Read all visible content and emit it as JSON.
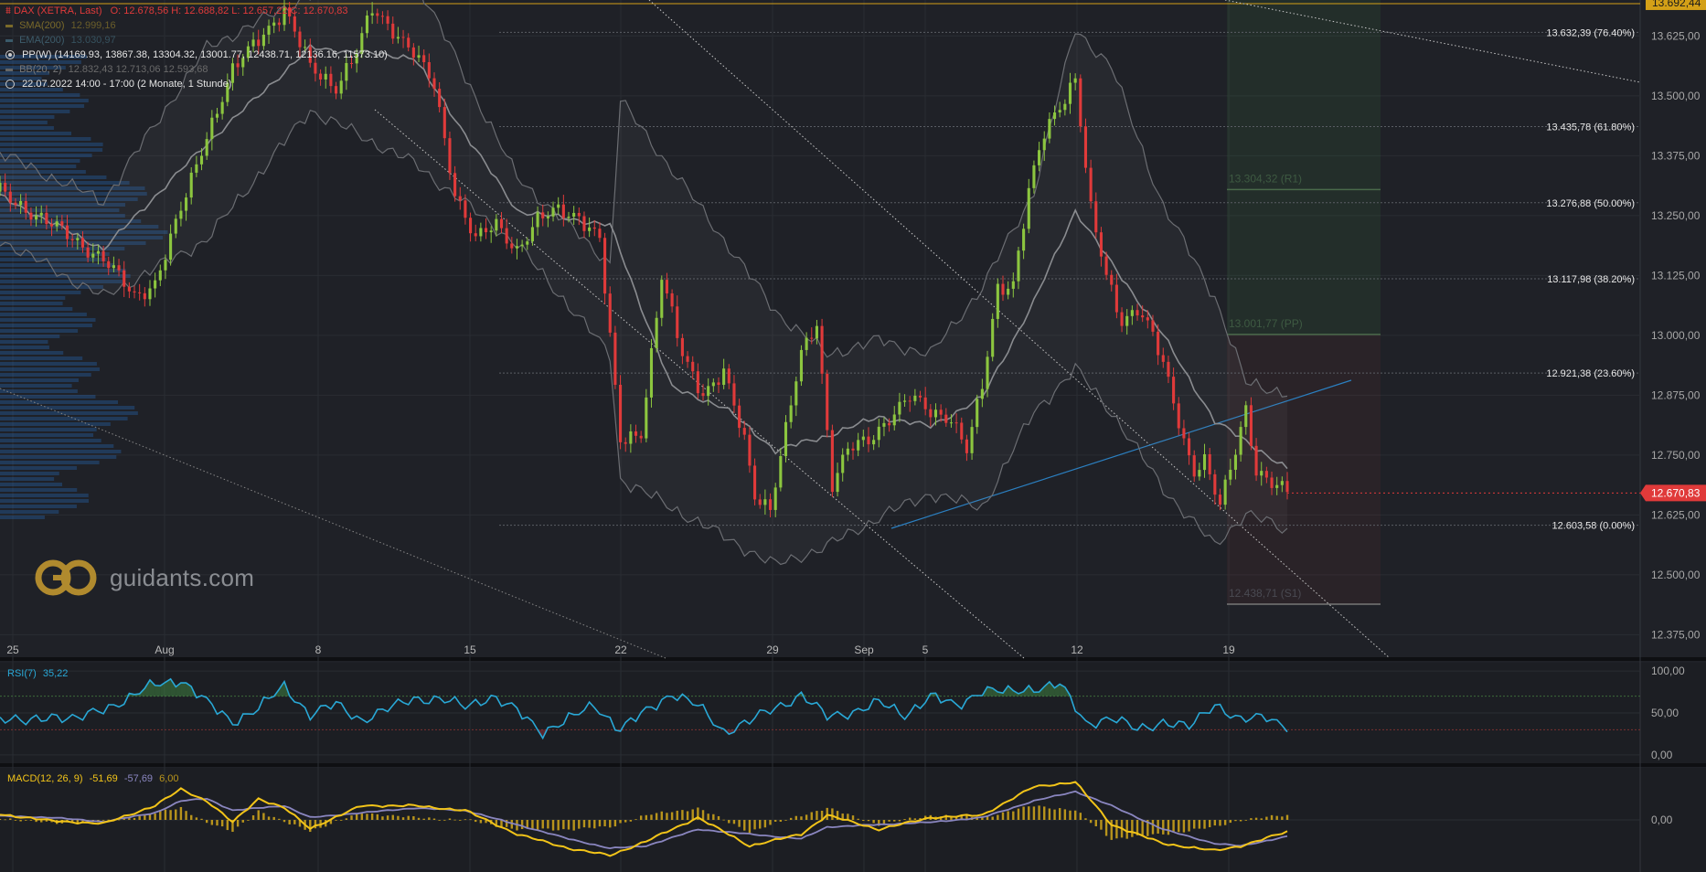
{
  "header": {
    "instrument": "DAX (XETRA, Last)",
    "ohlc": "O: 12.678,56  H: 12.688,82  L: 12.657,22  C: 12.670,83",
    "sma_label": "SMA(200)",
    "sma_value": "12.999,16",
    "ema_label": "EMA(200)",
    "ema_value": "13.030,97",
    "pp_line": "PP(W)  (14169.93, 13867.38, 13304.32, 13001.77, 12438.71, 12136.16, 11573.10)",
    "bb_label": "BB(20, 2)",
    "bb_values": "12.832,43  12.713,06  12.593,68",
    "time_line": "22.07.2022 14:00 - 17:00   (2 Monate, 1 Stunde)"
  },
  "logo": {
    "text": "guidants.com"
  },
  "colors": {
    "background": "#1f2127",
    "bull": "#8cc63f",
    "bear": "#e03a3a",
    "rsi": "#29a8d6",
    "macd": "#f2c419",
    "signal": "#8a86c0",
    "histogram": "#b8941c",
    "last_price_tag": "#e03a3a",
    "top_price_tag": "#d4a017"
  },
  "chart_data": [
    {
      "type": "candlestick",
      "ylim": [
        12330,
        13700
      ],
      "y_ticks": [
        "13.625,00",
        "13.500,00",
        "13.375,00",
        "13.250,00",
        "13.125,00",
        "13.000,00",
        "12.875,00",
        "12.750,00",
        "12.625,00",
        "12.500,00",
        "12.375,00"
      ],
      "x_ticks": [
        "25",
        "Aug",
        "8",
        "15",
        "22",
        "29",
        "Sep",
        "5",
        "12",
        "19"
      ],
      "last_price": "12.670,83",
      "top_price": "13.692,44",
      "fib_levels": [
        {
          "label": "13.632,39 (76.40%)",
          "value": 13632.39
        },
        {
          "label": "13.435,78 (61.80%)",
          "value": 13435.78
        },
        {
          "label": "13.276,88 (50.00%)",
          "value": 13276.88
        },
        {
          "label": "13.117,98 (38.20%)",
          "value": 13117.98
        },
        {
          "label": "12.921,38 (23.60%)",
          "value": 12921.38
        },
        {
          "label": "12.603,58 (0.00%)",
          "value": 12603.58
        }
      ],
      "pivot_levels": [
        {
          "label": "13.304,32 (R1)",
          "value": 13304.32
        },
        {
          "label": "13.001,77 (PP)",
          "value": 13001.77
        },
        {
          "label": "12.438,71 (S1)",
          "value": 12438.71
        }
      ],
      "close_path": [
        [
          0,
          13300
        ],
        [
          10,
          13230
        ],
        [
          20,
          13160
        ],
        [
          26,
          13080
        ],
        [
          30,
          13110
        ],
        [
          35,
          13260
        ],
        [
          40,
          13420
        ],
        [
          45,
          13550
        ],
        [
          50,
          13620
        ],
        [
          55,
          13680
        ],
        [
          60,
          13560
        ],
        [
          65,
          13520
        ],
        [
          69,
          13590
        ],
        [
          72,
          13680
        ],
        [
          76,
          13640
        ],
        [
          80,
          13590
        ],
        [
          84,
          13520
        ],
        [
          88,
          13300
        ],
        [
          92,
          13200
        ],
        [
          96,
          13230
        ],
        [
          100,
          13180
        ],
        [
          104,
          13240
        ],
        [
          108,
          13260
        ],
        [
          112,
          13250
        ],
        [
          116,
          13200
        ],
        [
          120,
          12780
        ],
        [
          124,
          12800
        ],
        [
          128,
          13120
        ],
        [
          132,
          12960
        ],
        [
          136,
          12880
        ],
        [
          140,
          12920
        ],
        [
          144,
          12780
        ],
        [
          146,
          12670
        ],
        [
          149,
          12640
        ],
        [
          152,
          12800
        ],
        [
          155,
          12960
        ],
        [
          158,
          13030
        ],
        [
          161,
          12690
        ],
        [
          164,
          12760
        ],
        [
          168,
          12780
        ],
        [
          172,
          12830
        ],
        [
          176,
          12870
        ],
        [
          180,
          12840
        ],
        [
          184,
          12830
        ],
        [
          187,
          12760
        ],
        [
          190,
          12890
        ],
        [
          193,
          13100
        ],
        [
          196,
          13110
        ],
        [
          199,
          13300
        ],
        [
          202,
          13420
        ],
        [
          205,
          13480
        ],
        [
          208,
          13540
        ],
        [
          211,
          13260
        ],
        [
          214,
          13120
        ],
        [
          217,
          13030
        ],
        [
          220,
          13060
        ],
        [
          223,
          13000
        ],
        [
          226,
          12900
        ],
        [
          229,
          12780
        ],
        [
          231,
          12720
        ],
        [
          233,
          12740
        ],
        [
          236,
          12640
        ],
        [
          239,
          12760
        ],
        [
          241,
          12850
        ],
        [
          243,
          12720
        ],
        [
          246,
          12690
        ],
        [
          249,
          12670
        ]
      ],
      "bollinger": {
        "upper": [
          [
            0,
            13380
          ],
          [
            20,
            13280
          ],
          [
            40,
            13600
          ],
          [
            60,
            13710
          ],
          [
            80,
            13750
          ],
          [
            100,
            13330
          ],
          [
            118,
            13150
          ],
          [
            120,
            13490
          ],
          [
            140,
            13200
          ],
          [
            150,
            13050
          ],
          [
            160,
            12960
          ],
          [
            170,
            12990
          ],
          [
            180,
            12960
          ],
          [
            190,
            13100
          ],
          [
            200,
            13300
          ],
          [
            208,
            13640
          ],
          [
            215,
            13560
          ],
          [
            225,
            13270
          ],
          [
            235,
            13080
          ],
          [
            241,
            12900
          ],
          [
            249,
            12880
          ]
        ],
        "middle": [
          [
            0,
            13290
          ],
          [
            20,
            13180
          ],
          [
            40,
            13400
          ],
          [
            60,
            13600
          ],
          [
            80,
            13580
          ],
          [
            100,
            13260
          ],
          [
            118,
            13230
          ],
          [
            130,
            12890
          ],
          [
            140,
            12850
          ],
          [
            150,
            12760
          ],
          [
            160,
            12790
          ],
          [
            170,
            12830
          ],
          [
            180,
            12810
          ],
          [
            190,
            12870
          ],
          [
            200,
            13070
          ],
          [
            208,
            13260
          ],
          [
            215,
            13150
          ],
          [
            225,
            13000
          ],
          [
            235,
            12820
          ],
          [
            241,
            12780
          ],
          [
            249,
            12720
          ]
        ],
        "lower": [
          [
            0,
            13200
          ],
          [
            20,
            13080
          ],
          [
            40,
            13200
          ],
          [
            60,
            13470
          ],
          [
            80,
            13360
          ],
          [
            100,
            13190
          ],
          [
            118,
            12960
          ],
          [
            120,
            12700
          ],
          [
            140,
            12580
          ],
          [
            150,
            12520
          ],
          [
            160,
            12560
          ],
          [
            170,
            12620
          ],
          [
            180,
            12670
          ],
          [
            190,
            12640
          ],
          [
            200,
            12840
          ],
          [
            208,
            12930
          ],
          [
            215,
            12840
          ],
          [
            225,
            12680
          ],
          [
            235,
            12560
          ],
          [
            241,
            12630
          ],
          [
            249,
            12590
          ]
        ]
      }
    },
    {
      "type": "line",
      "title": "RSI(7)",
      "last_value": "35,22",
      "ylim": [
        -10,
        110
      ],
      "y_ticks": [
        "100,00",
        "50,00",
        "0,00"
      ],
      "levels": [
        70,
        30
      ],
      "values": [
        [
          0,
          45
        ],
        [
          5,
          38
        ],
        [
          10,
          48
        ],
        [
          15,
          42
        ],
        [
          20,
          55
        ],
        [
          25,
          68
        ],
        [
          30,
          84
        ],
        [
          35,
          90
        ],
        [
          40,
          62
        ],
        [
          45,
          40
        ],
        [
          50,
          55
        ],
        [
          55,
          82
        ],
        [
          60,
          48
        ],
        [
          65,
          60
        ],
        [
          70,
          42
        ],
        [
          75,
          54
        ],
        [
          80,
          68
        ],
        [
          85,
          66
        ],
        [
          90,
          58
        ],
        [
          95,
          70
        ],
        [
          100,
          52
        ],
        [
          105,
          28
        ],
        [
          110,
          42
        ],
        [
          115,
          60
        ],
        [
          120,
          30
        ],
        [
          125,
          52
        ],
        [
          130,
          74
        ],
        [
          135,
          58
        ],
        [
          140,
          28
        ],
        [
          145,
          40
        ],
        [
          150,
          56
        ],
        [
          155,
          72
        ],
        [
          160,
          45
        ],
        [
          165,
          52
        ],
        [
          170,
          62
        ],
        [
          175,
          48
        ],
        [
          180,
          70
        ],
        [
          185,
          58
        ],
        [
          190,
          78
        ],
        [
          195,
          74
        ],
        [
          200,
          80
        ],
        [
          205,
          84
        ],
        [
          210,
          38
        ],
        [
          215,
          44
        ],
        [
          220,
          30
        ],
        [
          225,
          40
        ],
        [
          230,
          32
        ],
        [
          235,
          62
        ],
        [
          240,
          40
        ],
        [
          245,
          46
        ],
        [
          249,
          35
        ]
      ]
    },
    {
      "type": "line",
      "title": "MACD(12, 26, 9)",
      "values_label": "-51,69",
      "signal_label": "-57,69",
      "hist_label": "6,00",
      "ylim": [
        -110,
        110
      ],
      "y_ticks": [
        "0,00"
      ],
      "macd": [
        [
          0,
          12
        ],
        [
          10,
          -2
        ],
        [
          20,
          -8
        ],
        [
          30,
          30
        ],
        [
          35,
          65
        ],
        [
          40,
          40
        ],
        [
          45,
          -5
        ],
        [
          50,
          45
        ],
        [
          55,
          25
        ],
        [
          60,
          -18
        ],
        [
          70,
          30
        ],
        [
          80,
          30
        ],
        [
          90,
          20
        ],
        [
          100,
          -30
        ],
        [
          110,
          -60
        ],
        [
          118,
          -75
        ],
        [
          125,
          -45
        ],
        [
          135,
          5
        ],
        [
          145,
          -55
        ],
        [
          155,
          -30
        ],
        [
          160,
          10
        ],
        [
          170,
          -20
        ],
        [
          180,
          5
        ],
        [
          190,
          10
        ],
        [
          200,
          70
        ],
        [
          208,
          80
        ],
        [
          215,
          -10
        ],
        [
          225,
          -50
        ],
        [
          235,
          -65
        ],
        [
          240,
          -55
        ],
        [
          249,
          -25
        ]
      ],
      "signal": [
        [
          0,
          8
        ],
        [
          10,
          5
        ],
        [
          20,
          -4
        ],
        [
          30,
          15
        ],
        [
          35,
          40
        ],
        [
          40,
          45
        ],
        [
          45,
          20
        ],
        [
          50,
          25
        ],
        [
          55,
          30
        ],
        [
          60,
          5
        ],
        [
          70,
          15
        ],
        [
          80,
          25
        ],
        [
          90,
          20
        ],
        [
          100,
          -10
        ],
        [
          110,
          -40
        ],
        [
          118,
          -60
        ],
        [
          125,
          -55
        ],
        [
          135,
          -20
        ],
        [
          145,
          -30
        ],
        [
          155,
          -40
        ],
        [
          160,
          -15
        ],
        [
          170,
          -10
        ],
        [
          180,
          -5
        ],
        [
          190,
          5
        ],
        [
          200,
          40
        ],
        [
          208,
          60
        ],
        [
          215,
          30
        ],
        [
          225,
          -20
        ],
        [
          235,
          -50
        ],
        [
          240,
          -55
        ],
        [
          249,
          -35
        ]
      ]
    }
  ]
}
